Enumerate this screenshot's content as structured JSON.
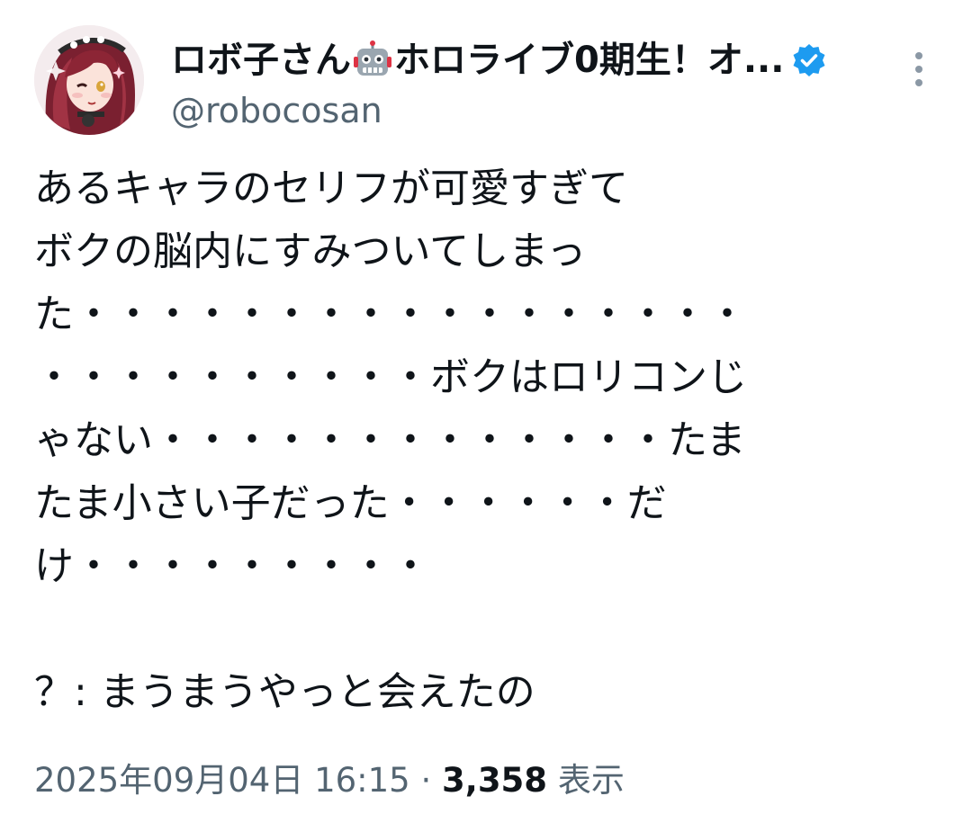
{
  "author": {
    "display_name_prefix": "ロボ子さん",
    "display_name_suffix": "ホロライブ0期生！オ...",
    "handle": "@robocosan",
    "robot_emoji_icon": "robot-face-icon",
    "verified_icon": "verified-badge-icon",
    "verified_color": "#1d9bf0",
    "avatar_icon": "avatar-image"
  },
  "more_icon": "more-vertical-icon",
  "tweet_text": "あるキャラのセリフが可愛すぎて\nボクの脳内にすみついてしまっ\nた・・・・・・・・・・・・・・・・・\n・・・・・・・・・・ボクはロリコンじ\nゃない・・・・・・・・・・・・・たま\nたま小さい子だった・・・・・・だ\nけ・・・・・・・・・\n\n？: まうまうやっと会えたの",
  "meta": {
    "timestamp": "2025年09月04日 16:15",
    "separator": "·",
    "views_count": "3,358",
    "views_label": "表示"
  },
  "colors": {
    "text": "#0f1419",
    "secondary": "#536471",
    "background": "#ffffff"
  }
}
